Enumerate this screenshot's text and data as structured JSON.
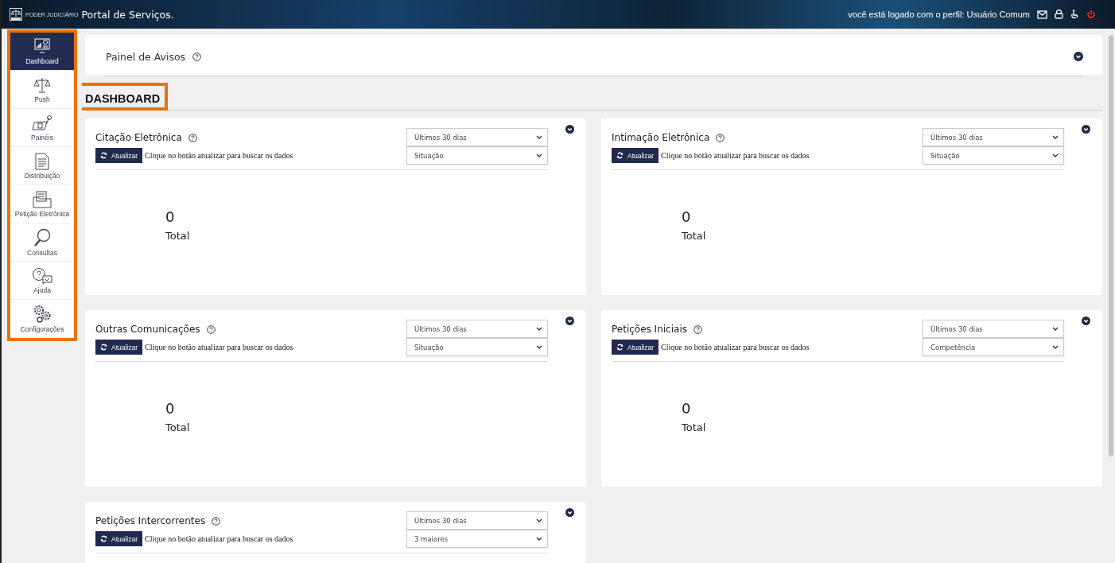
{
  "header": {
    "logo_text": "PODER JUDICIÁRIO",
    "title": "Portal de Serviços.",
    "user_text": "você está logado com o perfil: Usuário Comum"
  },
  "sidebar": {
    "items": [
      {
        "label": "Dashboard",
        "kind": "dashboard",
        "selected": true
      },
      {
        "label": "Push",
        "kind": "scale",
        "selected": false
      },
      {
        "label": "Painéis",
        "kind": "panels",
        "selected": false
      },
      {
        "label": "Distribuição",
        "kind": "document",
        "selected": false
      },
      {
        "label": "Petição Eletrônica",
        "kind": "folder",
        "selected": false
      },
      {
        "label": "Consultas",
        "kind": "search",
        "selected": false
      },
      {
        "label": "Ajuda",
        "kind": "help",
        "selected": false
      },
      {
        "label": "Configurações",
        "kind": "gears",
        "selected": false
      }
    ]
  },
  "notices": {
    "title": "Painel de Avisos"
  },
  "heading": "DASHBOARD",
  "cards": [
    {
      "title": "Citação Eletrônica",
      "button": "Atualizar",
      "hint": "Clique no botão atualizar para buscar os dados",
      "period": "Últimos 30 dias",
      "filter": "Situação",
      "count": "0",
      "total_label": "Total"
    },
    {
      "title": "Intimação Eletrônica",
      "button": "Atualizar",
      "hint": "Clique no botão atualizar para buscar os dados",
      "period": "Últimos 30 dias",
      "filter": "Situação",
      "count": "0",
      "total_label": "Total"
    },
    {
      "title": "Outras Comunicações",
      "button": "Atualizar",
      "hint": "Clique no botão atualizar para buscar os dados",
      "period": "Últimos 30 dias",
      "filter": "Situação",
      "count": "0",
      "total_label": "Total"
    },
    {
      "title": "Petições Iniciais",
      "button": "Atualizar",
      "hint": "Clique no botão atualizar para buscar os dados",
      "period": "Últimos 30 dias",
      "filter": "Competência",
      "count": "0",
      "total_label": "Total"
    },
    {
      "title": "Petições Intercorrentes",
      "button": "Atualizar",
      "hint": "Clique no botão atualizar para buscar os dados",
      "period": "Últimos 30 dias",
      "filter": "3 maiores"
    }
  ]
}
